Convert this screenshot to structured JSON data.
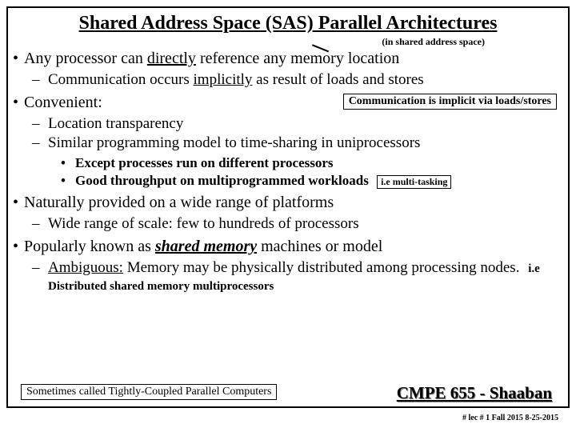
{
  "title_plain": "Shared Address Space (SAS) Parallel Architectures",
  "parenthetical": "(in shared address space)",
  "bullets": {
    "p1": "Any processor can ",
    "p1_u": "directly",
    "p1_b": " reference any memory location",
    "p1_sub_a": "Communication occurs ",
    "p1_sub_u": "implicitly",
    "p1_sub_b": " as result of loads and stores",
    "p2": "Convenient:",
    "p2_note": "Communication is implicit via loads/stores",
    "p2_sub1": "Location transparency",
    "p2_sub2": "Similar programming model to time-sharing in uniprocessors",
    "p2_ss1": "Except processes run on different processors",
    "p2_ss2": "Good throughput on multiprogrammed workloads",
    "p2_ss2_note": "i.e multi-tasking",
    "p3": "Naturally provided on a wide range of platforms",
    "p3_sub1": "Wide range of scale: few to hundreds of processors",
    "p4_a": "Popularly known as ",
    "p4_u": "shared memory",
    "p4_b": " machines or model",
    "p4_sub_u": "Ambiguous:",
    "p4_sub_a": "  Memory may be physically distributed among processing nodes.",
    "p4_note": "i.e Distributed shared memory multiprocessors"
  },
  "footer_left": "Sometimes called Tightly-Coupled Parallel Computers",
  "course": "CMPE 655 - Shaaban",
  "meta": "#  lec # 1   Fall 2015   8-25-2015"
}
